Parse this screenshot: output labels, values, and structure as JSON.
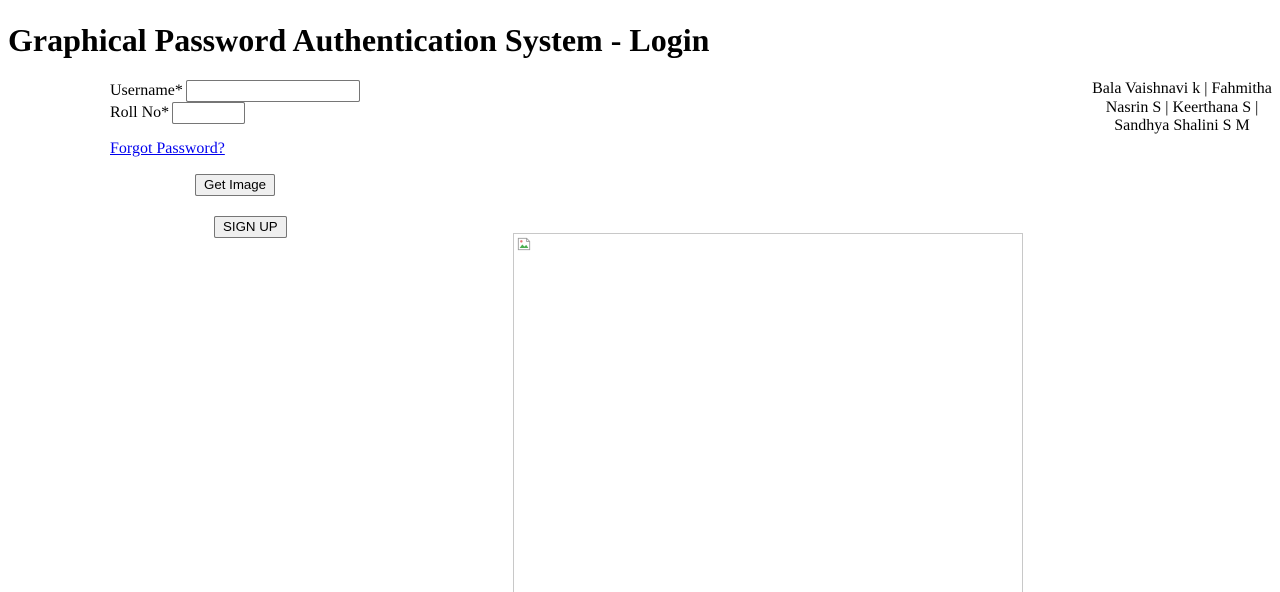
{
  "page": {
    "title": "Graphical Password Authentication System - Login"
  },
  "form": {
    "username_label": "Username*",
    "username_value": "",
    "roll_label": "Roll No*",
    "roll_value": "",
    "forgot_link": "Forgot Password?",
    "get_image_button": "Get Image",
    "signup_button": "SIGN UP"
  },
  "credits": {
    "text": "Bala Vaishnavi k | Fahmitha Nasrin S | Keerthana S | Sandhya Shalini S M"
  },
  "image": {
    "icon": "broken-image-icon"
  }
}
